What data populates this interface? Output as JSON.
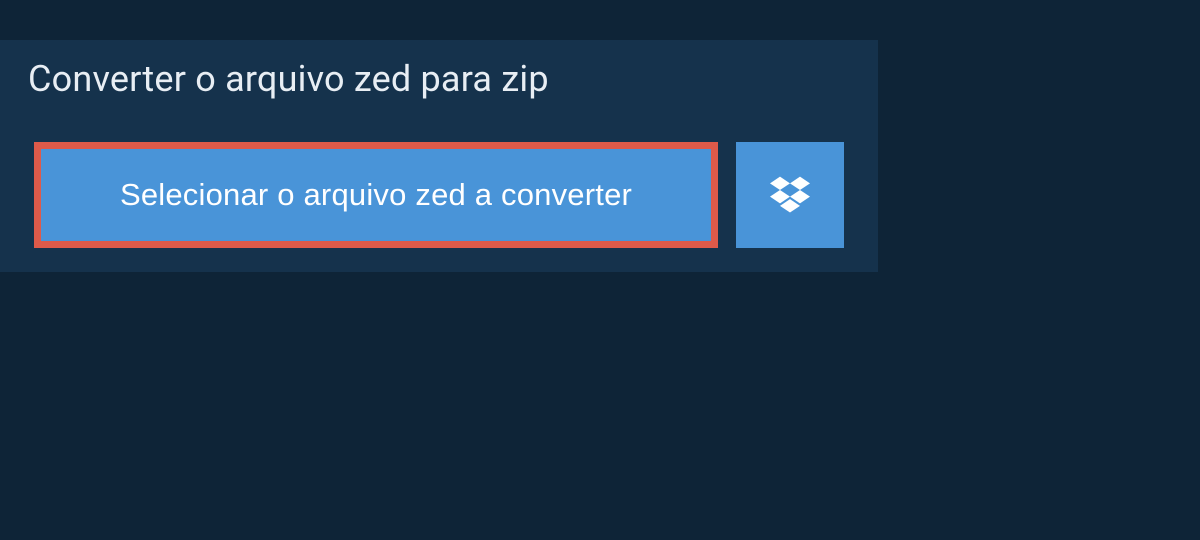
{
  "header": {
    "title": "Converter o arquivo zed para zip"
  },
  "actions": {
    "select_file_label": "Selecionar o arquivo zed a converter",
    "dropbox_label": "Dropbox"
  },
  "colors": {
    "page_bg": "#0e2437",
    "panel_bg": "#15324c",
    "button_bg": "#4994d8",
    "highlight_border": "#de5a4a",
    "text_light": "#e8eef4"
  }
}
